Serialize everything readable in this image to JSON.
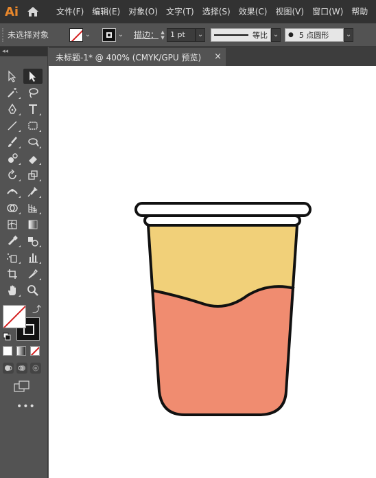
{
  "app": {
    "logo": "Ai",
    "home_icon": "home-icon"
  },
  "menu": [
    "文件(F)",
    "编辑(E)",
    "对象(O)",
    "文字(T)",
    "选择(S)",
    "效果(C)",
    "视图(V)",
    "窗口(W)",
    "帮助"
  ],
  "control": {
    "selection_label": "未选择对象",
    "stroke_label": "描边：",
    "stroke_weight": "1 pt",
    "profile_label": "等比",
    "brush_label": "5 点圆形"
  },
  "document": {
    "tab_title": "未标题-1* @ 400% (CMYK/GPU 预览)",
    "close": "×"
  },
  "toolbar": {
    "collapse": "◂◂",
    "more": "•••"
  },
  "colors": {
    "cup_top": "#F1D079",
    "cup_bottom": "#F08C70",
    "outline": "#111111",
    "fill_none_slash": "#D31F1F"
  }
}
